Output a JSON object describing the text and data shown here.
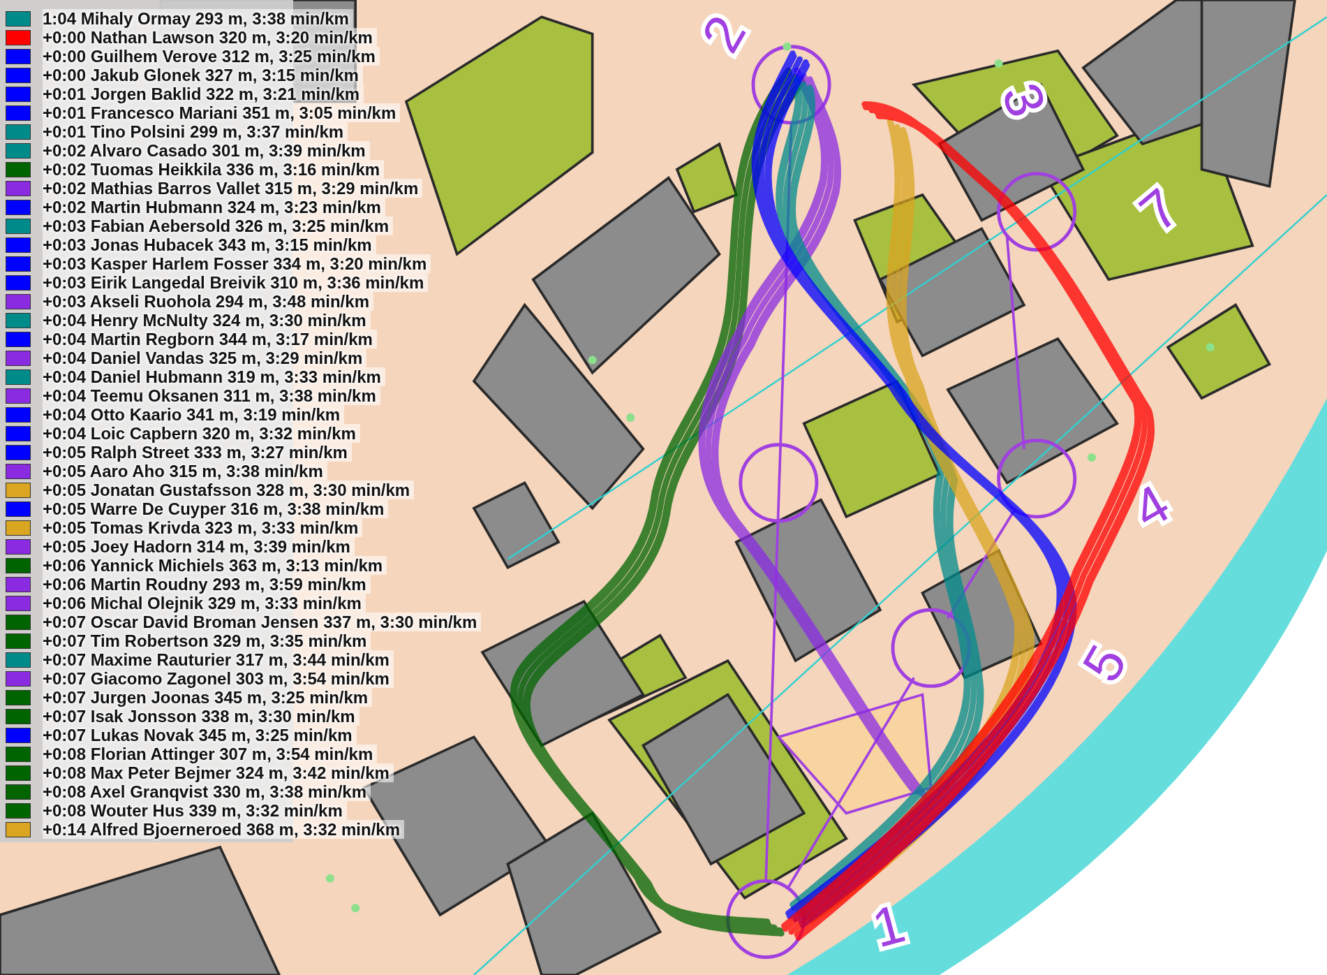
{
  "legend": [
    {
      "label": "1:04 Mihaly Ormay 293 m, 3:38 min/km",
      "color": "#008b8b"
    },
    {
      "label": "+0:00 Nathan Lawson 320 m, 3:20 min/km",
      "color": "#ff0000"
    },
    {
      "label": "+0:00 Guilhem Verove 312 m, 3:25 min/km",
      "color": "#0000ff"
    },
    {
      "label": "+0:00 Jakub Glonek 327 m, 3:15 min/km",
      "color": "#0000ff"
    },
    {
      "label": "+0:01 Jorgen Baklid 322 m, 3:21 min/km",
      "color": "#0000ff"
    },
    {
      "label": "+0:01 Francesco Mariani 351 m, 3:05 min/km",
      "color": "#0000ff"
    },
    {
      "label": "+0:01 Tino Polsini 299 m, 3:37 min/km",
      "color": "#008b8b"
    },
    {
      "label": "+0:02 Alvaro Casado 301 m, 3:39 min/km",
      "color": "#008b8b"
    },
    {
      "label": "+0:02 Tuomas Heikkila 336 m, 3:16 min/km",
      "color": "#006400"
    },
    {
      "label": "+0:02 Mathias Barros Vallet 315 m, 3:29 min/km",
      "color": "#8a2be2"
    },
    {
      "label": "+0:02 Martin Hubmann 324 m, 3:23 min/km",
      "color": "#0000ff"
    },
    {
      "label": "+0:03 Fabian Aebersold 326 m, 3:25 min/km",
      "color": "#008b8b"
    },
    {
      "label": "+0:03 Jonas Hubacek 343 m, 3:15 min/km",
      "color": "#0000ff"
    },
    {
      "label": "+0:03 Kasper Harlem Fosser 334 m, 3:20 min/km",
      "color": "#0000ff"
    },
    {
      "label": "+0:03 Eirik Langedal Breivik 310 m, 3:36 min/km",
      "color": "#0000ff"
    },
    {
      "label": "+0:03 Akseli Ruohola 294 m, 3:48 min/km",
      "color": "#8a2be2"
    },
    {
      "label": "+0:04 Henry McNulty 324 m, 3:30 min/km",
      "color": "#008b8b"
    },
    {
      "label": "+0:04 Martin Regborn 344 m, 3:17 min/km",
      "color": "#0000ff"
    },
    {
      "label": "+0:04 Daniel Vandas 325 m, 3:29 min/km",
      "color": "#8a2be2"
    },
    {
      "label": "+0:04 Daniel Hubmann 319 m, 3:33 min/km",
      "color": "#008b8b"
    },
    {
      "label": "+0:04 Teemu Oksanen 311 m, 3:38 min/km",
      "color": "#8a2be2"
    },
    {
      "label": "+0:04 Otto Kaario 341 m, 3:19 min/km",
      "color": "#0000ff"
    },
    {
      "label": "+0:04 Loic Capbern 320 m, 3:32 min/km",
      "color": "#0000ff"
    },
    {
      "label": "+0:05 Ralph Street 333 m, 3:27 min/km",
      "color": "#0000ff"
    },
    {
      "label": "+0:05 Aaro Aho 315 m, 3:38 min/km",
      "color": "#8a2be2"
    },
    {
      "label": "+0:05 Jonatan Gustafsson 328 m, 3:30 min/km",
      "color": "#daa520"
    },
    {
      "label": "+0:05 Warre De Cuyper 316 m, 3:38 min/km",
      "color": "#0000ff"
    },
    {
      "label": "+0:05 Tomas Krivda 323 m, 3:33 min/km",
      "color": "#daa520"
    },
    {
      "label": "+0:05 Joey Hadorn 314 m, 3:39 min/km",
      "color": "#8a2be2"
    },
    {
      "label": "+0:06 Yannick Michiels 363 m, 3:13 min/km",
      "color": "#006400"
    },
    {
      "label": "+0:06 Martin Roudny 293 m, 3:59 min/km",
      "color": "#8a2be2"
    },
    {
      "label": "+0:06 Michal Olejnik 329 m, 3:33 min/km",
      "color": "#8a2be2"
    },
    {
      "label": "+0:07 Oscar David Broman Jensen 337 m, 3:30 min/km",
      "color": "#006400"
    },
    {
      "label": "+0:07 Tim Robertson 329 m, 3:35 min/km",
      "color": "#006400"
    },
    {
      "label": "+0:07 Maxime Rauturier 317 m, 3:44 min/km",
      "color": "#008b8b"
    },
    {
      "label": "+0:07 Giacomo Zagonel 303 m, 3:54 min/km",
      "color": "#8a2be2"
    },
    {
      "label": "+0:07 Jurgen Joonas 345 m, 3:25 min/km",
      "color": "#006400"
    },
    {
      "label": "+0:07 Isak Jonsson 338 m, 3:30 min/km",
      "color": "#006400"
    },
    {
      "label": "+0:07 Lukas Novak 345 m, 3:25 min/km",
      "color": "#0000ff"
    },
    {
      "label": "+0:08 Florian Attinger 307 m, 3:54 min/km",
      "color": "#006400"
    },
    {
      "label": "+0:08 Max Peter Bejmer 324 m, 3:42 min/km",
      "color": "#006400"
    },
    {
      "label": "+0:08 Axel Granqvist 330 m, 3:38 min/km",
      "color": "#006400"
    },
    {
      "label": "+0:08 Wouter Hus 339 m, 3:32 min/km",
      "color": "#006400"
    },
    {
      "label": "+0:14 Alfred Bjoerneroed 368 m, 3:32 min/km",
      "color": "#daa520"
    }
  ],
  "controls": [
    "2",
    "3",
    "7",
    "4",
    "5",
    "1"
  ]
}
